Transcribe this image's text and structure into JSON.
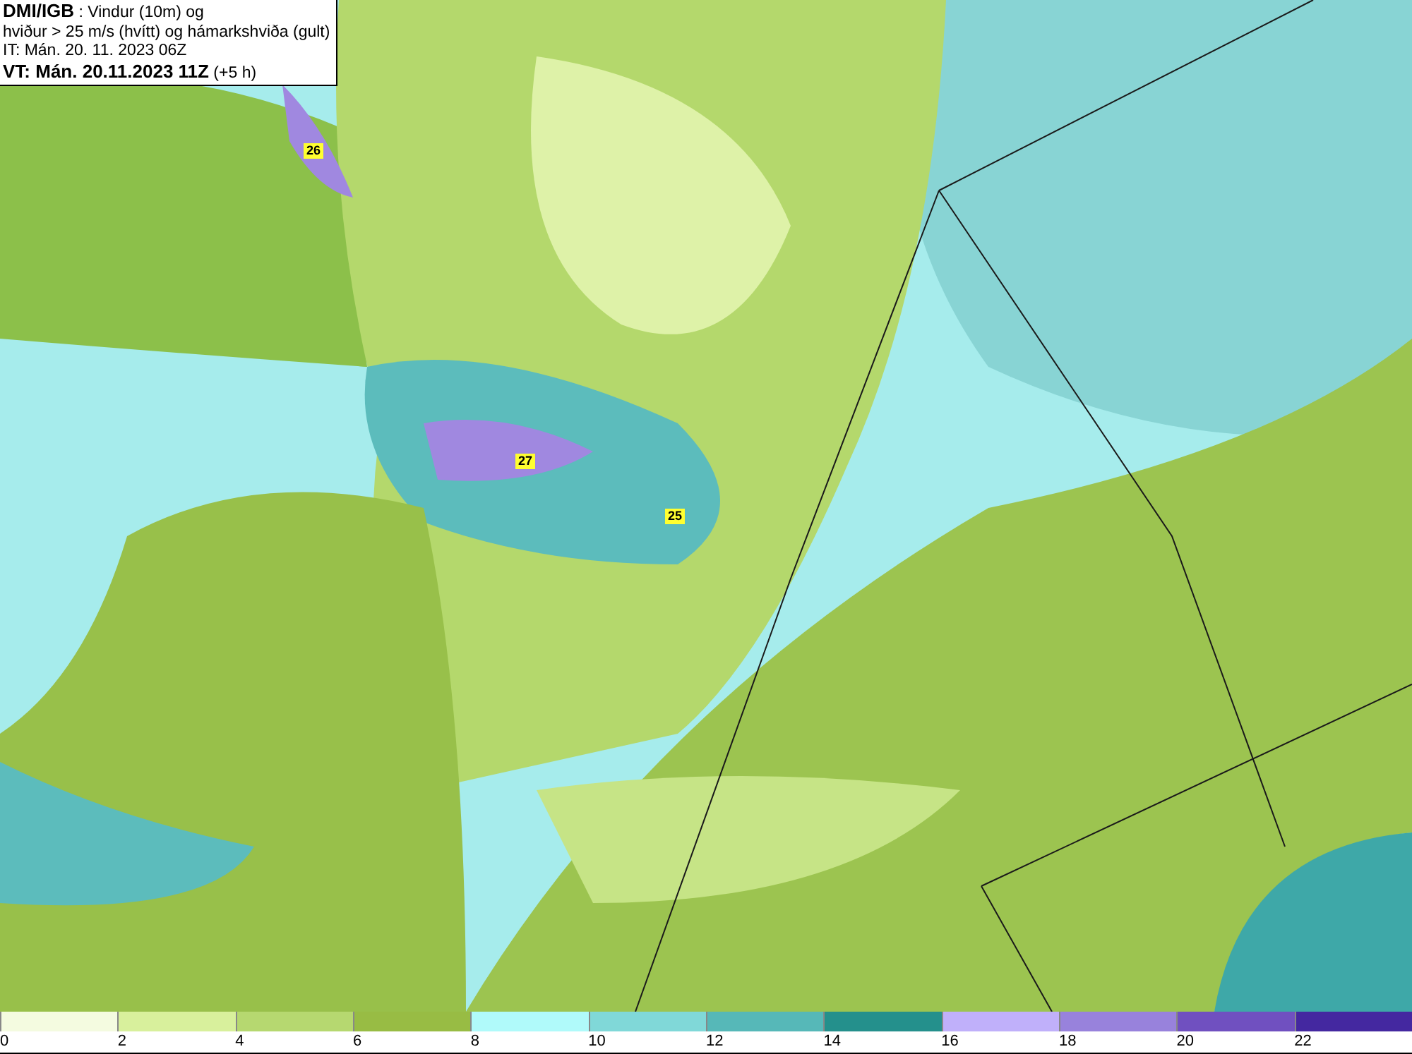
{
  "header": {
    "lines": [
      "**DMI/IGB** : Vindur (10m) og",
      "hviður > 25 m/s (hvítt) og hámarkshviða (gult)",
      "IT: Mán. 20. 11. 2023 06Z",
      "**VT: Mán. 20.11.2023 11Z** (+5 h)"
    ]
  },
  "map": {
    "gust_labels": [
      "26",
      "27",
      "25"
    ]
  },
  "legend": {
    "bins": [
      {
        "color": "#f4fbe0"
      },
      {
        "color": "#d8f09c"
      },
      {
        "color": "#b6d870"
      },
      {
        "color": "#98bc44"
      },
      {
        "color": "#b0fafa"
      },
      {
        "color": "#80d8d8"
      },
      {
        "color": "#56b8b8"
      },
      {
        "color": "#24908c"
      },
      {
        "color": "#c0b0fa"
      },
      {
        "color": "#9882dc"
      },
      {
        "color": "#7050c0"
      },
      {
        "color": "#4428a0"
      }
    ],
    "ticks": [
      "0",
      "2",
      "4",
      "6",
      "8",
      "10",
      "12",
      "14",
      "16",
      "18",
      "20",
      "22"
    ]
  }
}
